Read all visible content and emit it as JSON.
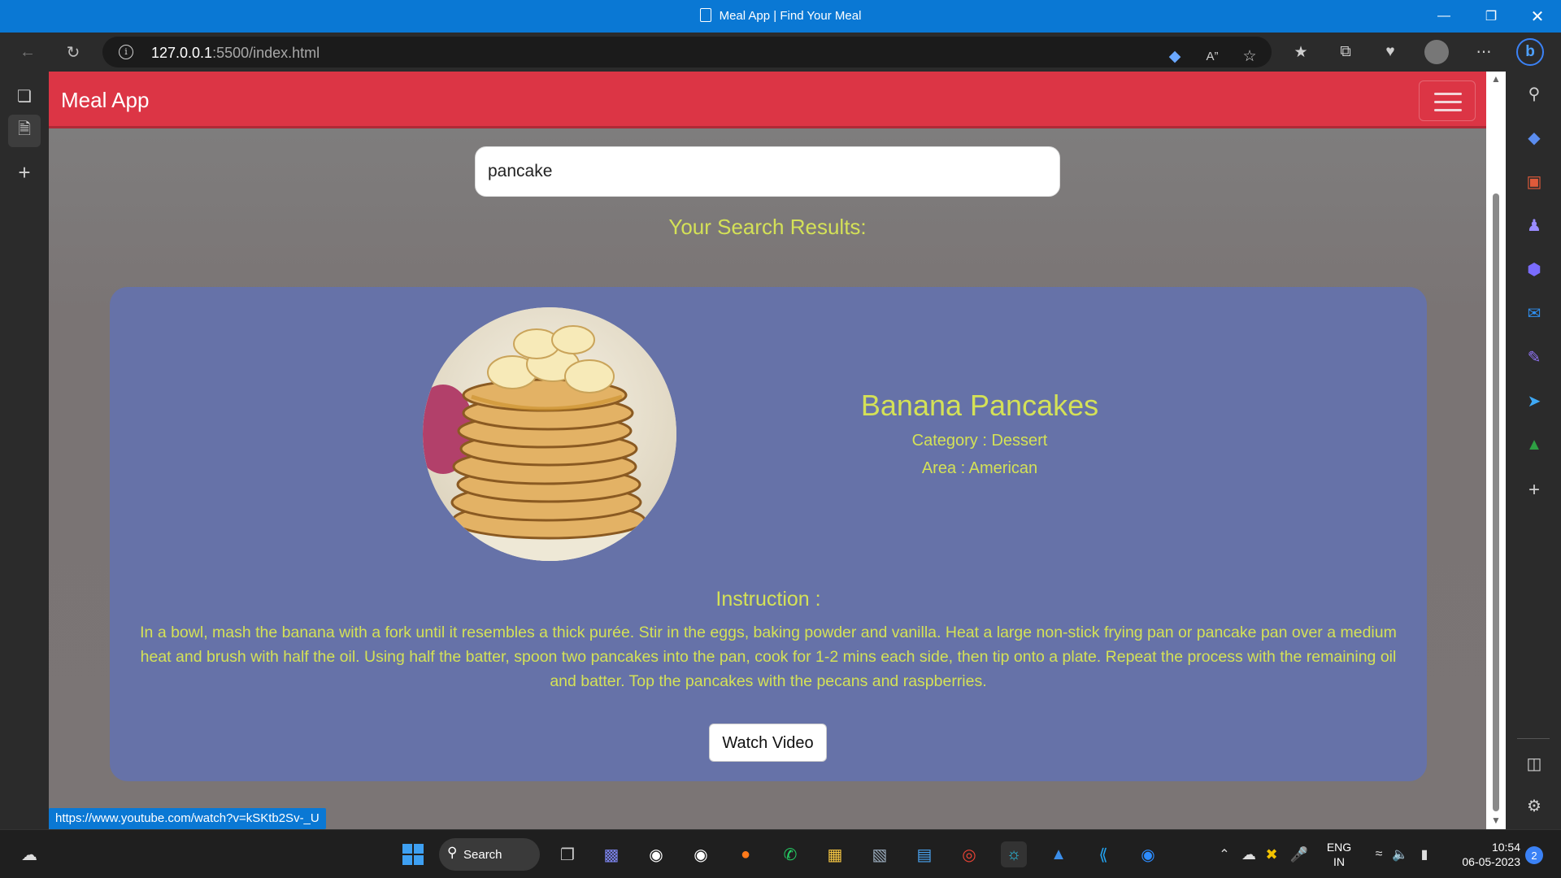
{
  "window": {
    "title": "Meal App | Find Your Meal",
    "minimize_icon": "minimize-icon",
    "maximize_icon": "restore-icon",
    "close_icon": "close-icon"
  },
  "browser": {
    "url_host": "127.0.0.1",
    "url_rest": ":5500/index.html",
    "status_url": "https://www.youtube.com/watch?v=kSKtb2Sv-_U"
  },
  "app": {
    "brand": "Meal App",
    "accent_color": "#dc3545",
    "search_value": "pancake",
    "results_heading": "Your Search Results:"
  },
  "meal": {
    "name": "Banana Pancakes",
    "category": "Category : Dessert",
    "area": "Area : American",
    "instruction_heading": "Instruction :",
    "instruction": "In a bowl, mash the banana with a fork until it resembles a thick purée. Stir in the eggs, baking powder and vanilla. Heat a large non-stick frying pan or pancake pan over a medium heat and brush with half the oil. Using half the batter, spoon two pancakes into the pan, cook for 1-2 mins each side, then tip onto a plate. Repeat the process with the remaining oil and batter. Top the pancakes with the pecans and raspberries.",
    "watch_button": "Watch Video"
  },
  "taskbar": {
    "search_label": "Search",
    "lang_top": "ENG",
    "lang_bottom": "IN",
    "time": "10:54",
    "date": "06-05-2023",
    "notification_count": "2"
  }
}
